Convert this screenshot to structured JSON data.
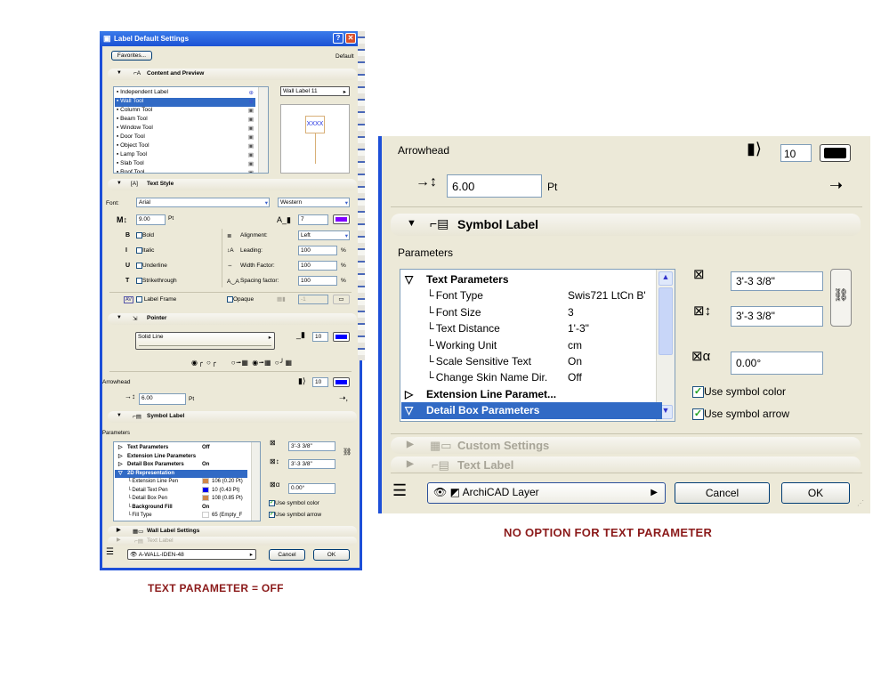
{
  "left_dialog": {
    "title": "Label Default Settings",
    "help_btn": "?",
    "close_btn": "✕",
    "favorites": "Favorites...",
    "default_label": "Default",
    "content_preview": {
      "header": "Content and Preview",
      "tools": [
        "Independent Label",
        "Wall Tool",
        "Column Tool",
        "Beam Tool",
        "Window Tool",
        "Door Tool",
        "Object Tool",
        "Lamp Tool",
        "Slab Tool",
        "Roof Tool"
      ],
      "selected_index": 1,
      "preview_select": "Wall Label 11",
      "preview_text": "XXXX"
    },
    "text_style": {
      "header": "Text Style",
      "font_label": "Font:",
      "font": "Arial",
      "script": "Western",
      "size": "9.00",
      "size_unit": "Pt",
      "pen": "7",
      "pen_color": "#8000ff",
      "bold": "Bold",
      "italic": "Italic",
      "underline": "Underline",
      "strikethrough": "Strikethrough",
      "alignment_label": "Alignment:",
      "alignment": "Left",
      "leading_label": "Leading:",
      "leading": "100",
      "width_label": "Width Factor:",
      "width": "100",
      "spacing_label": "Spacing factor:",
      "spacing": "100",
      "percent": "%",
      "label_frame": "Label Frame",
      "opaque": "Opaque",
      "bg_pen": "-1"
    },
    "pointer": {
      "header": "Pointer",
      "line_type": "Solid Line",
      "pen": "10",
      "pen_color": "#0000ff"
    },
    "arrowhead": {
      "label": "Arrowhead",
      "pen": "10",
      "pen_color": "#0000ff",
      "size": "6.00",
      "unit": "Pt"
    },
    "symbol_label": {
      "header": "Symbol Label",
      "parameters_label": "Parameters",
      "params": [
        {
          "name": "Text Parameters",
          "value": "Off",
          "type": "group"
        },
        {
          "name": "Extension Line Parameters",
          "value": "",
          "type": "group"
        },
        {
          "name": "Detail Box Parameters",
          "value": "On",
          "type": "group"
        },
        {
          "name": "2D Representation",
          "value": "",
          "type": "group-open",
          "selected": true
        },
        {
          "name": "Extension Line Pen",
          "value": "106 (0.20 Pt)",
          "swatch": "#d0884a"
        },
        {
          "name": "Detail Text Pen",
          "value": "10 (0.43 Pt)",
          "swatch": "#0000ee"
        },
        {
          "name": "Detail Box Pen",
          "value": "108 (0.85 Pt)",
          "swatch": "#d0884a"
        },
        {
          "name": "Background Fill",
          "value": "On",
          "bold": true
        },
        {
          "name": "Fill Type",
          "value": "65 (Empty_F",
          "swatch": "#ffffff"
        }
      ],
      "width": "3'-3 3/8\"",
      "height": "3'-3 3/8\"",
      "angle": "0.00°",
      "use_symbol_color": "Use symbol color",
      "use_symbol_arrow": "Use symbol arrow"
    },
    "wall_label_settings": "Wall Label Settings",
    "text_label": "Text Label",
    "layer": "A-WALL-IDEN-48",
    "cancel": "Cancel",
    "ok": "OK"
  },
  "left_caption": "TEXT PARAMETER = OFF",
  "right_dialog": {
    "arrowhead_label": "Arrowhead",
    "arrow_pen": "10",
    "arrow_pen_color": "#000000",
    "arrow_size": "6.00",
    "arrow_unit": "Pt",
    "symbol_label_header": "Symbol Label",
    "parameters_label": "Parameters",
    "params": [
      {
        "name": "Text Parameters",
        "value": "",
        "type": "group-open"
      },
      {
        "name": "Font Type",
        "value": "Swis721 LtCn B'"
      },
      {
        "name": "Font Size",
        "value": "3"
      },
      {
        "name": "Text Distance",
        "value": "1'-3\""
      },
      {
        "name": "Working Unit",
        "value": "cm"
      },
      {
        "name": "Scale Sensitive Text",
        "value": "On"
      },
      {
        "name": "Change Skin Name Dir.",
        "value": "Off"
      },
      {
        "name": "Extension Line Paramet...",
        "value": "",
        "type": "group"
      },
      {
        "name": "Detail Box Parameters",
        "value": "",
        "type": "group-open",
        "selected": true
      }
    ],
    "width": "3'-3 3/8\"",
    "height": "3'-3 3/8\"",
    "angle": "0.00°",
    "use_symbol_color": "Use symbol color",
    "use_symbol_arrow": "Use symbol arrow",
    "custom_settings": "Custom Settings",
    "text_label": "Text Label",
    "layer": "ArchiCAD Layer",
    "cancel": "Cancel",
    "ok": "OK"
  },
  "right_caption": "NO OPTION FOR TEXT PARAMETER"
}
